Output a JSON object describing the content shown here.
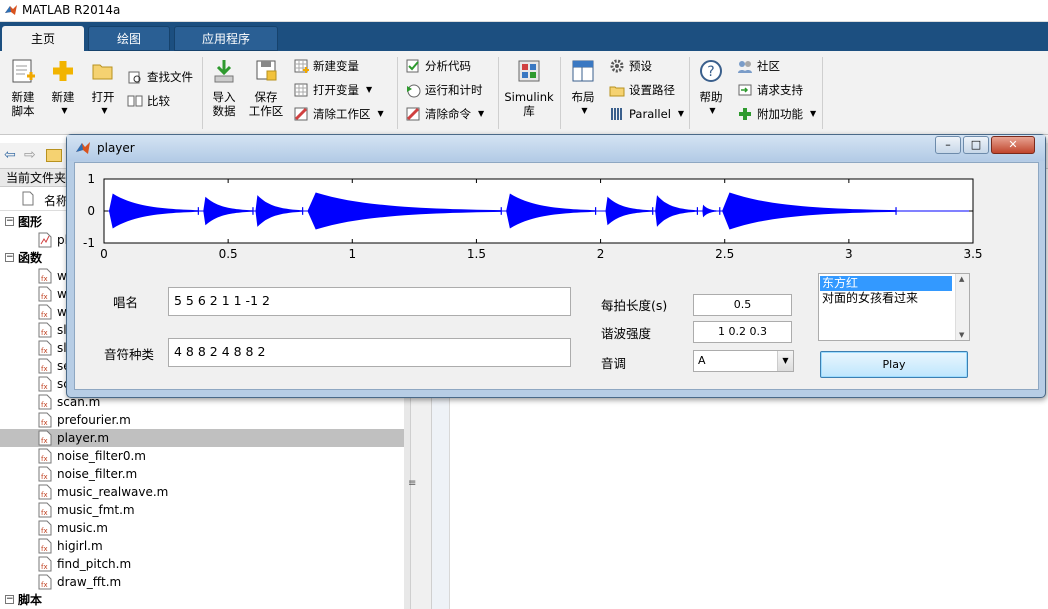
{
  "matlab": {
    "title": "MATLAB R2014a",
    "tabs": [
      {
        "label": "主页"
      },
      {
        "label": "绘图"
      },
      {
        "label": "应用程序"
      }
    ],
    "ribbon": {
      "new_script": "新建\n脚本",
      "new_script_l1": "新建",
      "new_script_l2": "脚本",
      "new": "新建",
      "open": "打开",
      "find_files": "查找文件",
      "compare": "比较",
      "import_l1": "导入",
      "import_l2": "数据",
      "save_ws_l1": "保存",
      "save_ws_l2": "工作区",
      "new_variable": "新建变量",
      "open_variable": "打开变量",
      "clear_workspace": "清除工作区",
      "analyze_code": "分析代码",
      "run_and_time": "运行和计时",
      "clear_commands": "清除命令",
      "simulink_l1": "Simulink",
      "simulink_l2": "库",
      "layout": "布局",
      "preferences": "预设",
      "set_path": "设置路径",
      "parallel": "Parallel",
      "help": "帮助",
      "community": "社区",
      "request_support": "请求支持",
      "addons": "附加功能"
    },
    "current_folder": "当前文件夹",
    "name_column": "名称",
    "tree": {
      "group_figures": "图形",
      "figure_item": "pl",
      "group_functions": "函数",
      "function_items": [
        "w",
        "w",
        "w",
        "sl",
        "sl",
        "se",
        "sc",
        "scan.m",
        "prefourier.m",
        "player.m",
        "noise_filter0.m",
        "noise_filter.m",
        "music_realwave.m",
        "music_fmt.m",
        "music.m",
        "higirl.m",
        "find_pitch.m",
        "draw_fft.m"
      ],
      "selected": "player.m",
      "group_scripts": "脚本"
    }
  },
  "player": {
    "title": "player",
    "chart_data": {
      "type": "line",
      "title": "",
      "xlabel": "",
      "ylabel": "",
      "xlim": [
        0,
        3.5
      ],
      "ylim": [
        -1,
        1
      ],
      "x_ticks": [
        "0",
        "0.5",
        "1",
        "1.5",
        "2",
        "2.5",
        "3",
        "3.5"
      ],
      "y_ticks": [
        "1",
        "0",
        "-1"
      ],
      "x_exponent_label": "4",
      "color": "#0000ff",
      "notes": [
        {
          "start": 0.02,
          "end": 0.38,
          "amp": 0.55
        },
        {
          "start": 0.4,
          "end": 0.6,
          "amp": 0.45
        },
        {
          "start": 0.61,
          "end": 0.8,
          "amp": 0.5
        },
        {
          "start": 0.82,
          "end": 1.6,
          "amp": 0.58
        },
        {
          "start": 1.62,
          "end": 1.98,
          "amp": 0.55
        },
        {
          "start": 2.02,
          "end": 2.21,
          "amp": 0.45
        },
        {
          "start": 2.22,
          "end": 2.39,
          "amp": 0.5
        },
        {
          "start": 2.41,
          "end": 2.48,
          "amp": 0.2
        },
        {
          "start": 2.49,
          "end": 3.19,
          "amp": 0.58
        }
      ]
    },
    "labels": {
      "solfege": "唱名",
      "note_type": "音符种类",
      "beat_length": "每拍长度(s)",
      "harmonics": "谐波强度",
      "key": "音调"
    },
    "values": {
      "solfege": "5 5 6 2 1 1 -1 2",
      "note_type": "4 8 8 2 4 8 8 2",
      "beat_length": "0.5",
      "harmonics": "1 0.2 0.3",
      "key": "A"
    },
    "songs": [
      "东方红",
      "对面的女孩看过来"
    ],
    "selected_song": "东方红",
    "play_label": "Play",
    "window_buttons": {
      "minimize": "–",
      "maximize": "□",
      "close": "✕"
    }
  }
}
